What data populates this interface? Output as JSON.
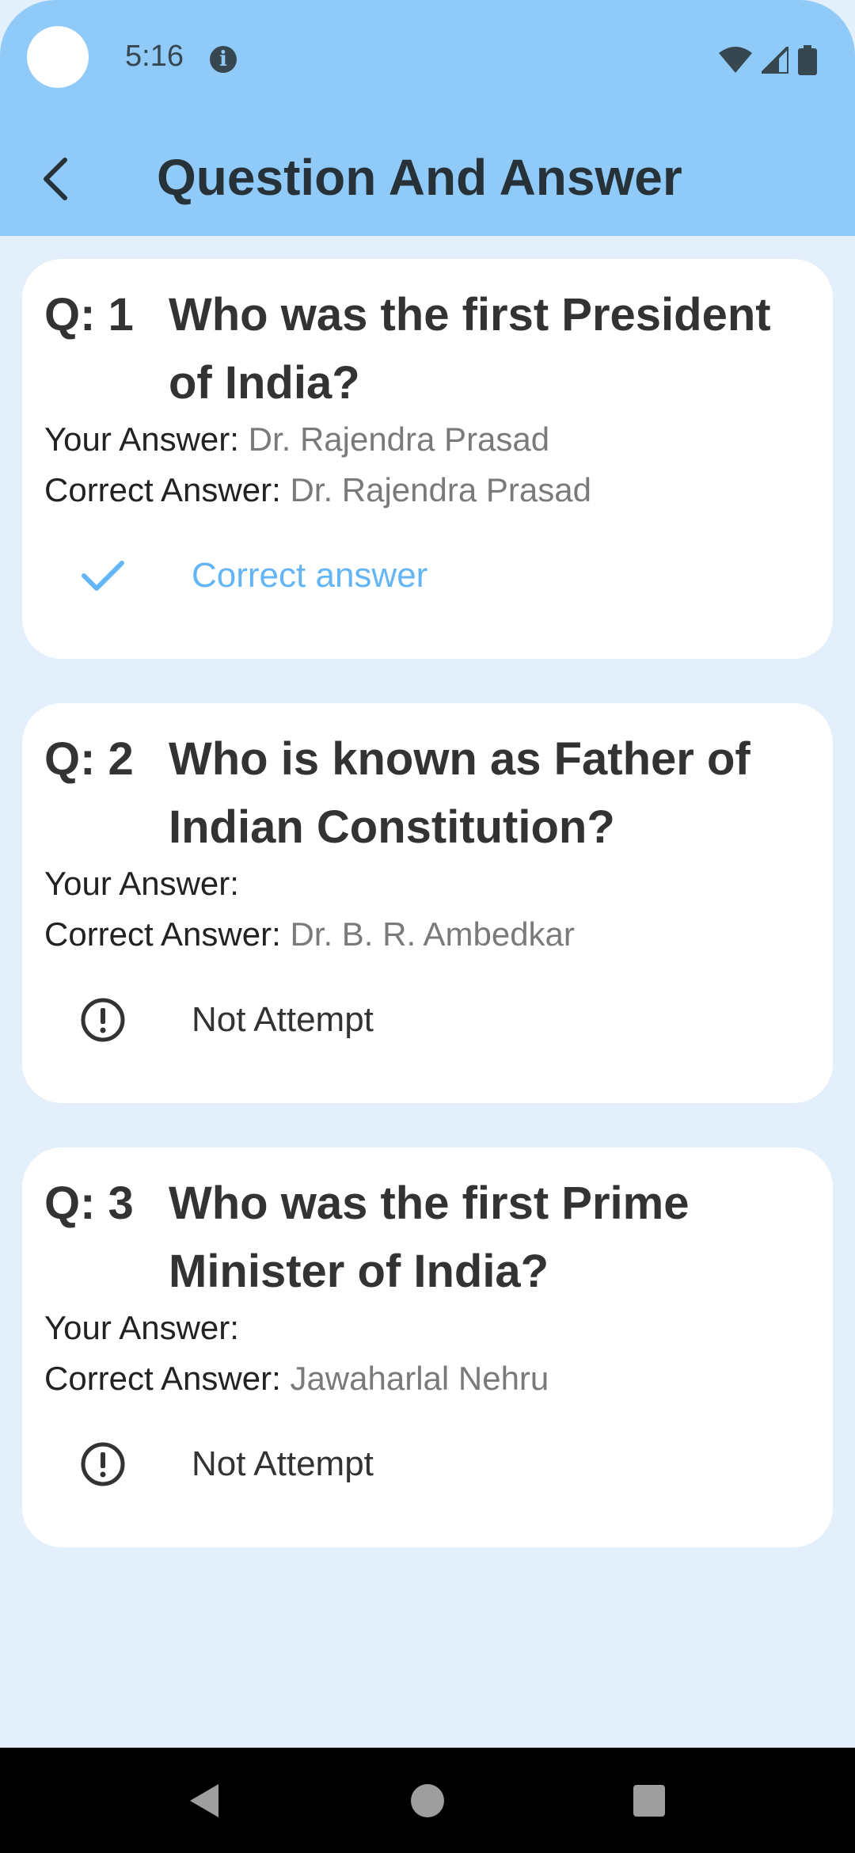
{
  "status_bar": {
    "time": "5:16"
  },
  "header": {
    "title": "Question And Answer"
  },
  "questions": [
    {
      "number": "Q: 1",
      "text": "Who was the first President of India?",
      "your_answer_label": "Your Answer:",
      "your_answer": "Dr. Rajendra Prasad",
      "correct_answer_label": "Correct Answer:",
      "correct_answer": "Dr. Rajendra Prasad",
      "status": "Correct answer",
      "status_icon": "check-icon"
    },
    {
      "number": "Q: 2",
      "text": "Who is known as Father of Indian Constitution?",
      "your_answer_label": "Your Answer:",
      "your_answer": "",
      "correct_answer_label": "Correct Answer:",
      "correct_answer": "Dr. B. R. Ambedkar",
      "status": "Not Attempt",
      "status_icon": "exclamation-circle-icon"
    },
    {
      "number": "Q: 3",
      "text": "Who was the first Prime Minister of India?",
      "your_answer_label": "Your Answer:",
      "your_answer": "",
      "correct_answer_label": "Correct Answer:",
      "correct_answer": "Jawaharlal Nehru",
      "status": "Not Attempt",
      "status_icon": "exclamation-circle-icon"
    }
  ],
  "colors": {
    "app_bar": "#90caf9",
    "background": "#e3f0fc",
    "correct": "#64b5f6",
    "answer_value": "#7a7a7a"
  }
}
